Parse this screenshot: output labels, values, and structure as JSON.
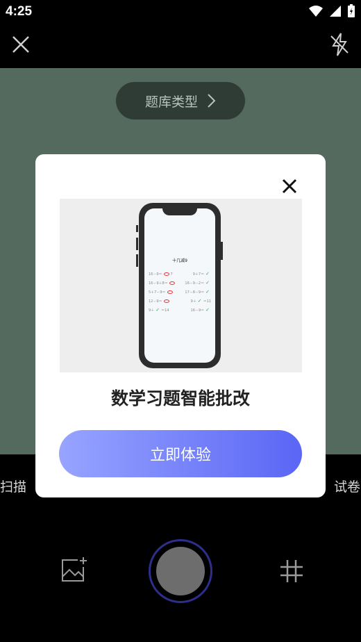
{
  "status_bar": {
    "time": "4:25"
  },
  "top_bar": {
    "close_icon": "close-icon",
    "flash_icon": "flash-off-icon"
  },
  "camera": {
    "question_bank_label": "题库类型",
    "chevron": "chevron-right-icon"
  },
  "modes": {
    "left_label": "扫描",
    "right_label": "试卷"
  },
  "bottom_bar": {
    "gallery_icon": "gallery-add-icon",
    "shutter": "shutter-button",
    "grid_icon": "grid-icon"
  },
  "modal": {
    "title": "数学习题智能批改",
    "cta_label": "立即体验",
    "illustration": {
      "sheet_title": "十几减9",
      "rows": [
        {
          "left": "16－9＝",
          "left_mark": "wrong",
          "left_after": "7",
          "right": "9＋7＝",
          "right_mark": "ok",
          "right_after": ""
        },
        {
          "left": "16－9＋8＝",
          "left_mark": "wrong",
          "left_after": "",
          "right": "16－9－2＝",
          "right_mark": "ok",
          "right_after": ""
        },
        {
          "left": "5＋7－9＝",
          "left_mark": "wrong",
          "left_after": "",
          "right": "17－8－9＝",
          "right_mark": "ok",
          "right_after": ""
        },
        {
          "left": "12－9＝",
          "left_mark": "wrong",
          "left_after": "",
          "right": "9＋",
          "right_mark": "ok",
          "right_after": "＝11"
        },
        {
          "left": "9＋",
          "left_mark": "ok",
          "left_after": "＝14",
          "right": "16－9＝",
          "right_mark": "ok",
          "right_after": ""
        }
      ]
    }
  },
  "colors": {
    "camera_bg": "#546a5e",
    "cta_start": "#97a4ff",
    "cta_end": "#5a66f5",
    "shutter_ring": "#2e2f8a"
  }
}
